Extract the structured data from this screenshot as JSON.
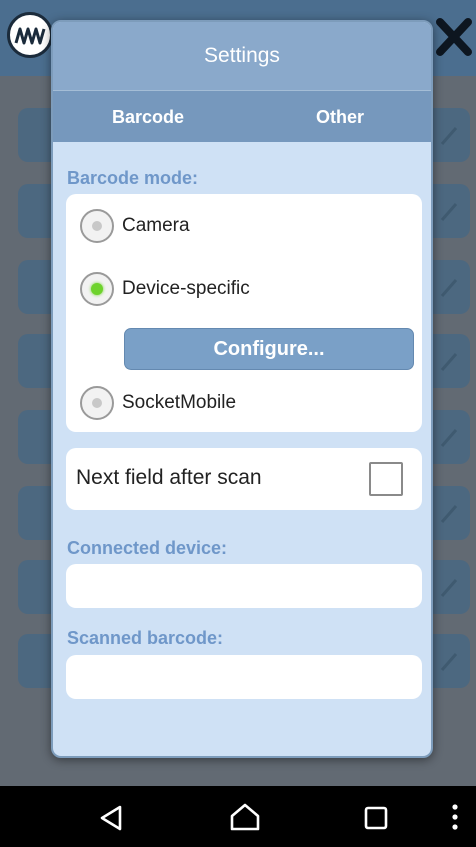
{
  "dialog": {
    "title": "Settings",
    "tabs": [
      {
        "label": "Barcode"
      },
      {
        "label": "Other"
      }
    ],
    "barcode_mode": {
      "label": "Barcode mode:",
      "options": [
        {
          "label": "Camera",
          "selected": false
        },
        {
          "label": "Device-specific",
          "selected": true
        },
        {
          "label": "SocketMobile",
          "selected": false
        }
      ],
      "configure_label": "Configure..."
    },
    "next_field": {
      "label": "Next field after scan",
      "checked": false
    },
    "connected_device": {
      "label": "Connected device:",
      "value": ""
    },
    "scanned_barcode": {
      "label": "Scanned barcode:",
      "value": ""
    }
  },
  "icons": {
    "app_logo": "logo-icon",
    "close": "close-icon",
    "row_arrow": "chevron-right-icon",
    "nav_back": "back-icon",
    "nav_home": "home-icon",
    "nav_recents": "recents-icon",
    "nav_menu": "more-vert-icon"
  },
  "colors": {
    "dialog_bg": "#cfe1f5",
    "title_bar": "#8aa9cb",
    "tab_bar": "#7698bd",
    "section_label": "#6f97c9",
    "button": "#7aa0c7",
    "radio_selected": "#6ed32c"
  }
}
